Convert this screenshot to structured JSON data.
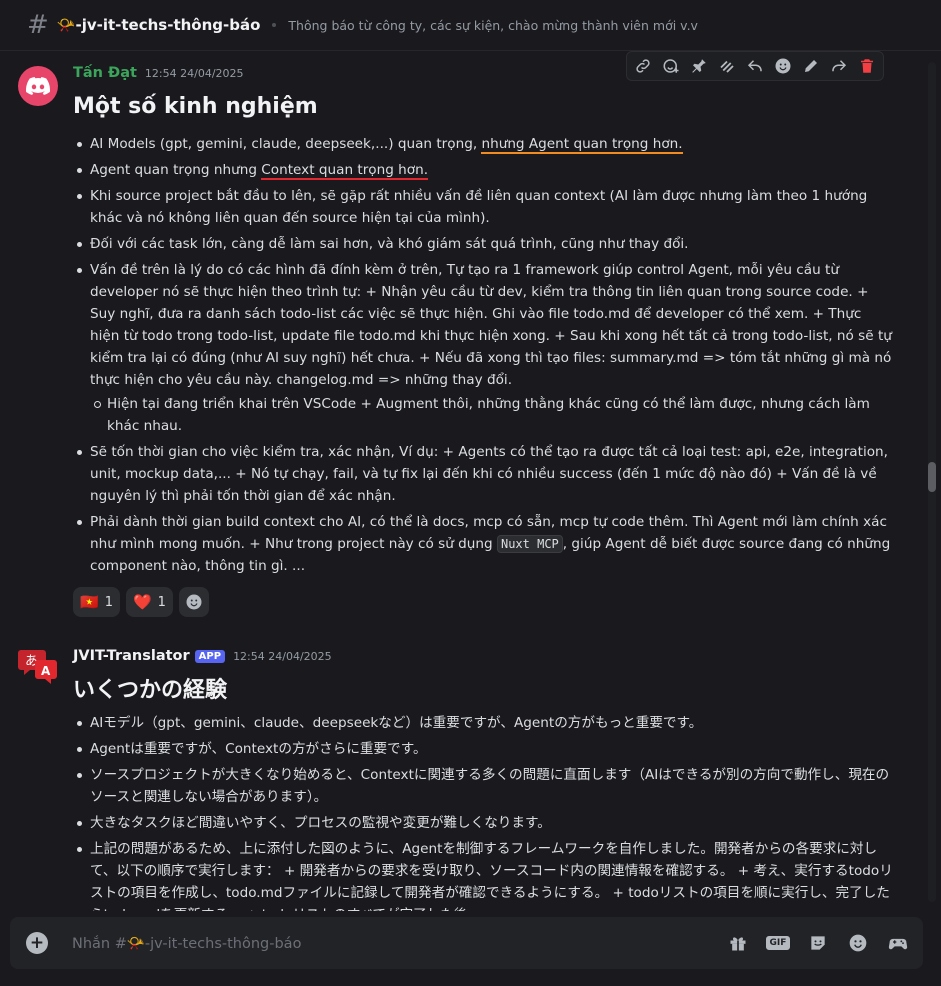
{
  "header": {
    "channel_name": "📯-jv-it-techs-thông-báo",
    "topic": "Thông báo từ công ty, các sự kiện, chào mừng thành viên mới v.v"
  },
  "msg1": {
    "author": "Tấn Đạt",
    "timestamp": "12:54 24/04/2025",
    "heading": "Một số kinh nghiệm",
    "b1_a": "AI Models (gpt, gemini, claude, deepseek,...) quan trọng, ",
    "b1_b": "nhưng Agent quan trọng hơn.",
    "b2_a": "Agent quan trọng nhưng ",
    "b2_b": "Context quan trọng hơn.",
    "b3": "Khi source project bắt đầu to lên, sẽ gặp rất nhiều vấn đề liên quan context (AI làm được nhưng làm theo 1 hướng khác và nó không liên quan đến source hiện tại của mình).",
    "b4": "Đối với các task lớn, càng dễ làm sai hơn, và khó giám sát quá trình, cũng như thay đổi.",
    "b5": "Vấn đề trên là lý do có các hình đã đính kèm ở trên, Tự tạo ra 1 framework giúp control Agent, mỗi yêu cầu từ developer nó sẽ thực hiện theo trình tự: + Nhận yêu cầu từ dev, kiểm tra thông tin liên quan trong source code. + Suy nghĩ, đưa ra danh sách todo-list các việc sẽ thực hiện. Ghi vào file todo.md để developer có thể xem. + Thực hiện từ todo trong todo-list, update file todo.md khi thực hiện xong. + Sau khi xong hết tất cả trong todo-list, nó sẽ tự kiểm tra lại có đúng (như AI suy nghĩ) hết chưa. + Nếu đã xong thì tạo files:  summary.md => tóm tắt những gì mà nó thực hiện cho yêu cầu này.  changelog.md => những thay đổi.",
    "b5_sub": "Hiện tại đang triển khai trên VSCode + Augment thôi, những thằng khác cũng có thể làm được, nhưng cách làm khác nhau.",
    "b6": "Sẽ tốn thời gian cho việc kiểm tra, xác nhận, Ví dụ:  + Agents có thể tạo ra được tất cả loại test: api, e2e, integration, unit, mockup data,... + Nó tự chạy, fail, và tự fix lại đến khi có nhiều success (đến 1 mức độ nào đó) + Vấn đề là về nguyên lý thì phải tốn thời gian để xác nhận.",
    "b7_a": "Phải dành thời gian build context cho AI, có thể là docs, mcp có sẵn, mcp tự code thêm. Thì Agent mới làm chính xác như mình mong muốn. + Như trong project này có sử dụng ",
    "b7_code": "Nuxt MCP",
    "b7_b": ", giúp Agent dễ biết được source đang có những component nào, thông tin gì. ...",
    "reactions": [
      {
        "emoji": "🇻🇳",
        "count": "1"
      },
      {
        "emoji": "❤️",
        "count": "1"
      }
    ]
  },
  "msg2": {
    "author": "JVIT-Translator",
    "app_tag": "APP",
    "timestamp": "12:54 24/04/2025",
    "heading": "いくつかの経験",
    "b1": "AIモデル（gpt、gemini、claude、deepseekなど）は重要ですが、Agentの方がもっと重要です。",
    "b2": "Agentは重要ですが、Contextの方がさらに重要です。",
    "b3": "ソースプロジェクトが大きくなり始めると、Contextに関連する多くの問題に直面します（AIはできるが別の方向で動作し、現在のソースと関連しない場合があります）。",
    "b4": "大きなタスクほど間違いやすく、プロセスの監視や変更が難しくなります。",
    "b5": "上記の問題があるため、上に添付した図のように、Agentを制御するフレームワークを自作しました。開発者からの各要求に対して、以下の順序で実行します： + 開発者からの要求を受け取り、ソースコード内の関連情報を確認する。 + 考え、実行するtodoリストの項目を作成し、todo.mdファイルに記録して開発者が確認できるようにする。 + todoリストの項目を順に実行し、完了したらtodo.mdを更新する。 + todoリストのすべてが完了した後、"
  },
  "composer": {
    "placeholder": "Nhắn #📯-jv-it-techs-thông-báo"
  },
  "icons": [
    "link-icon",
    "add-reaction-icon",
    "pin-icon",
    "thread-icon",
    "reply-icon",
    "emoji-icon",
    "edit-icon",
    "forward-icon",
    "delete-icon",
    "gift-icon",
    "gif-icon",
    "sticker-icon",
    "emoji-icon",
    "game-icon"
  ],
  "colors": {
    "accent": "#5865f2",
    "underline_orange": "#f28b22",
    "underline_red": "#e0282e",
    "danger": "#f23f43"
  }
}
